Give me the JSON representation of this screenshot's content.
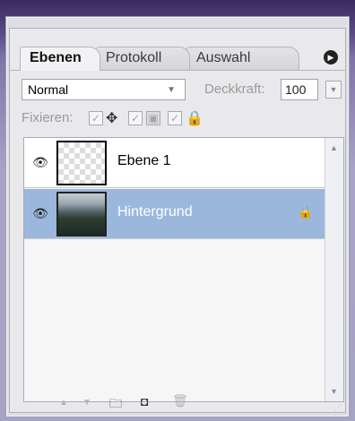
{
  "tabs": [
    {
      "label": "Ebenen",
      "active": true
    },
    {
      "label": "Protokoll",
      "active": false
    },
    {
      "label": "Auswahl",
      "active": false
    }
  ],
  "panel_menu_icon": "circle-arrow-icon",
  "blend_mode": {
    "value": "Normal"
  },
  "opacity": {
    "label": "Deckkraft:",
    "value": "100"
  },
  "lock": {
    "label": "Fixieren:"
  },
  "layers": [
    {
      "name": "Ebene 1",
      "visible": true,
      "selected": false,
      "thumbnail": "transparent"
    },
    {
      "name": "Hintergrund",
      "visible": true,
      "selected": true,
      "locked": true,
      "thumbnail": "landscape-photo"
    }
  ],
  "colors": {
    "selected_row": "#9bb8dc",
    "panel_bg": "#e9e9ec"
  }
}
